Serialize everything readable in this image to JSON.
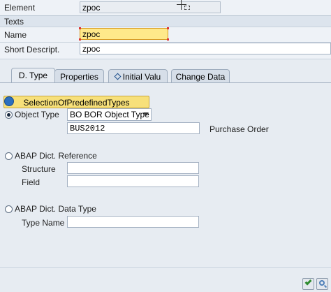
{
  "header": {
    "element_label": "Element",
    "element_value": "zpoc",
    "texts_label": "Texts",
    "name_label": "Name",
    "name_value": "zpoc",
    "short_desc_label": "Short Descript.",
    "short_desc_value": "zpoc"
  },
  "tabs": [
    {
      "label": "D. Type",
      "active": true
    },
    {
      "label": "Properties",
      "active": false
    },
    {
      "label": "Initial Valu",
      "active": false
    },
    {
      "label": "Change Data",
      "active": false
    }
  ],
  "panel": {
    "selection_button_label": "SelectionOfPredefinedTypes",
    "object_type_label": "Object Type",
    "object_type_selected": "BO BOR Object Type",
    "object_type_value": "BUS2012",
    "object_type_description": "Purchase Order",
    "abap_dict_ref_label": "ABAP Dict. Reference",
    "structure_label": "Structure",
    "structure_value": "",
    "field_label": "Field",
    "field_value": "",
    "abap_dict_type_label": "ABAP Dict. Data Type",
    "type_name_label": "Type Name",
    "type_name_value": ""
  },
  "colors": {
    "accent_highlight": "#ffe98a",
    "button_yellow": "#f7e07a",
    "panel_bg": "#e7ecf2",
    "check_green": "#2e8b2e"
  },
  "icons": {
    "selection": "selection-icon",
    "confirm": "checkmark-icon",
    "search": "magnifier-icon"
  }
}
